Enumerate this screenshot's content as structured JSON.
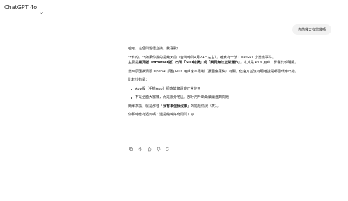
{
  "header": {
    "model_name": "ChatGPT 4o"
  },
  "user_message": "你前幾天有當機嗎",
  "reply": {
    "p1": "哈哈，這個問題很直接，我喜歡！",
    "p2": "**有的，**如果你說的是幾天前（台灣時間4月24日左右），確實有一波 ChatGPT 小當機事件。",
    "p3_prefix": "主要是",
    "p3_bold1": "網頁版（browser版）出現「500錯誤」或「網頁無法正常運作」",
    "p3_suffix": "，尤其是 Plus 用戶，影響比較明顯。",
    "p4": "當時原因推測跟 OpenAI 調整 Plus 用戶速率限制（讓回應更快）有關，但官方並沒有明確說是哪個環節出錯。",
    "p5": "比較妙的是：",
    "bullets": [
      "App版（手機App）卻時其實還能正常使用",
      "不是全面大當機，而是部分地區、部分用戶斷斷續續遇到問題"
    ],
    "p6_prefix": "簡單來講，就是那種「",
    "p6_bold": "我有事但我沒事",
    "p6_suffix": "」的尷尬情況（笑）。",
    "p7": "你那時也有遇到嗎？還是純粹好奇問問？",
    "p7_emoji": "😄"
  },
  "actions": [
    "copy-icon",
    "speaker-icon",
    "thumbs-up-icon",
    "thumbs-down-icon",
    "regenerate-icon"
  ]
}
